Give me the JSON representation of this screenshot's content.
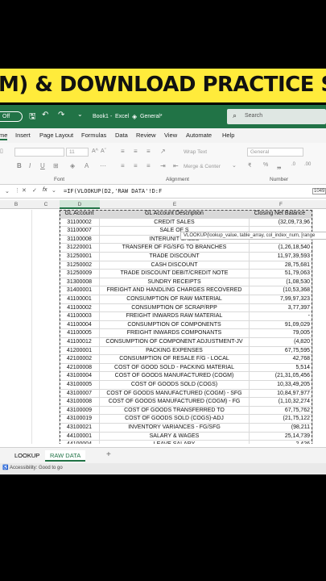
{
  "banner": {
    "text": "M) & DOWNLOAD PRACTICE SHEET"
  },
  "titlebar": {
    "autosave": "Off",
    "workbook": "Book1",
    "app": "Excel",
    "sensitivity": "General*",
    "search_placeholder": "Search"
  },
  "menu": {
    "items": [
      "me",
      "Insert",
      "Page Layout",
      "Formulas",
      "Data",
      "Review",
      "View",
      "Automate",
      "Help"
    ]
  },
  "ribbon": {
    "font_size": "11",
    "wrap_text": "Wrap Text",
    "merge_center": "Merge & Center",
    "number_format": "General",
    "group_font": "Font",
    "group_alignment": "Alignment",
    "group_number": "Number",
    "bold": "B",
    "italic": "I",
    "underline": "U"
  },
  "formula_bar": {
    "formula": "=IF(VLOOKUP(D2,'RAW DATA'!D:F",
    "right_value": "1049"
  },
  "columns": [
    "B",
    "C",
    "D",
    "E",
    "F"
  ],
  "tooltip": "VLOOKUP(lookup_value, table_array, col_index_num, [range",
  "table": {
    "headers": [
      "GL Account",
      "GL Account Description",
      "Closing Net Balance"
    ],
    "rows": [
      [
        "31100002",
        "CREDIT SALES",
        "(32,09,73,96"
      ],
      [
        "31100007",
        "SALE OF S",
        ""
      ],
      [
        "31100008",
        "INTERUNIT SALES",
        ""
      ],
      [
        "31220001",
        "TRANSFER OF FG/SFG TO BRANCHES",
        "(1,26,18,540"
      ],
      [
        "31250001",
        "TRADE DISCOUNT",
        "11,97,39,593"
      ],
      [
        "31250002",
        "CASH DISCOUNT",
        "28,75,681"
      ],
      [
        "31250009",
        "TRADE DISCOUNT DEBIT/CREDIT NOTE",
        "51,79,063"
      ],
      [
        "31300008",
        "SUNDRY RECEIPTS",
        "(1,08,530"
      ],
      [
        "31400001",
        "FREIGHT AND HANDLING CHARGES RECOVERED",
        "(10,53,368"
      ],
      [
        "41100001",
        "CONSUMPTION OF RAW MATERIAL",
        "7,99,97,323"
      ],
      [
        "41100002",
        "CONSUMPTION OF SCRAP/RPP",
        "3,77,397"
      ],
      [
        "41100003",
        "FREIGHT INWARDS RAW MATERIAL",
        "-"
      ],
      [
        "41100004",
        "CONSUMPTION OF COMPONENTS",
        "91,09,029"
      ],
      [
        "41100005",
        "FREIGHT INWARDS COMPONANTS",
        "79,005"
      ],
      [
        "41100012",
        "CONSUMPTION OF COMPONENT ADJUSTMENT-JV",
        "(4,820"
      ],
      [
        "41200001",
        "PACKING EXPENSES",
        "67,75,595"
      ],
      [
        "42100002",
        "CONSUMPTION OF RESALE F/G - LOCAL",
        "42,768"
      ],
      [
        "42100008",
        "COST OF GOOD SOLD - PACKING MATERIAL",
        "5,514"
      ],
      [
        "43100004",
        "COST OF GOODS MANUFACTURED (COGM)",
        "(21,31,05,456"
      ],
      [
        "43100005",
        "COST OF GOODS SOLD (COGS)",
        "10,33,49,205"
      ],
      [
        "43100007",
        "COST OF GOODS MANUFACTURED (COGM) - SFG",
        "10,84,97,977"
      ],
      [
        "43100008",
        "COST OF GOODS MANUFACTURED (COGM) - FG",
        "(1,10,32,274"
      ],
      [
        "43100009",
        "COST OF GOODS TRANSFERRED TO",
        "67,75,762"
      ],
      [
        "43100019",
        "COST OF GOODS SOLD (COGS)-ADJ",
        "(21,75,122"
      ],
      [
        "43100021",
        "INVENTORY VARIANCES - FG/SFG",
        "(98,211"
      ],
      [
        "44100001",
        "SALARY & WAGES",
        "25,14,739"
      ],
      [
        "44100004",
        "LEAVE SALARY",
        "2,426"
      ]
    ]
  },
  "sheets": [
    "LOOKUP",
    "RAW DATA"
  ],
  "status": {
    "accessibility": "Accessibility: Good to go"
  }
}
